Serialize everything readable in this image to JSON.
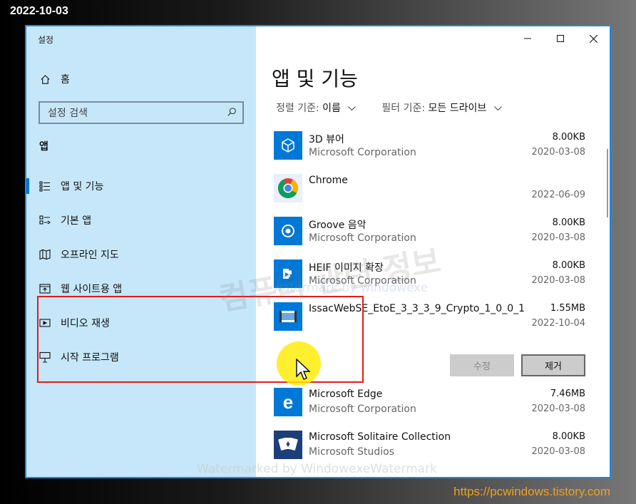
{
  "stamp": {
    "date": "2022-10-03",
    "url": "https://pcwindows.tistory.com"
  },
  "window": {
    "title": "설정"
  },
  "sidebar": {
    "home": "홈",
    "search_placeholder": "설정 검색",
    "section": "앱",
    "items": [
      {
        "label": "앱 및 기능",
        "icon": "apps-features-icon",
        "active": true
      },
      {
        "label": "기본 앱",
        "icon": "default-apps-icon",
        "active": false
      },
      {
        "label": "오프라인 지도",
        "icon": "offline-maps-icon",
        "active": false
      },
      {
        "label": "웹 사이트용 앱",
        "icon": "apps-for-websites-icon",
        "active": false
      },
      {
        "label": "비디오 재생",
        "icon": "video-playback-icon",
        "active": false
      },
      {
        "label": "시작 프로그램",
        "icon": "startup-icon",
        "active": false
      }
    ]
  },
  "main": {
    "title": "앱 및 기능",
    "sort_label": "정렬 기준:",
    "sort_value": "이름",
    "filter_label": "필터 기준:",
    "filter_value": "모든 드라이브",
    "apps": [
      {
        "name": "3D 뷰어",
        "publisher": "Microsoft Corporation",
        "size": "8.00KB",
        "date": "2020-03-08",
        "icon": "3d-viewer-icon"
      },
      {
        "name": "Chrome",
        "publisher": "",
        "size": "",
        "date": "2022-06-09",
        "icon": "chrome-icon"
      },
      {
        "name": "Groove 음악",
        "publisher": "Microsoft Corporation",
        "size": "8.00KB",
        "date": "2020-03-08",
        "icon": "groove-music-icon"
      },
      {
        "name": "HEIF 이미지 확장",
        "publisher": "Microsoft Corporation",
        "size": "8.00KB",
        "date": "2020-03-08",
        "icon": "heif-extension-icon"
      },
      {
        "name": "IssacWebSE_EtoE_3_3_3_9_Crypto_1_0_0_1",
        "publisher": "",
        "size": "1.55MB",
        "date": "2022-10-04",
        "icon": "issac-app-icon"
      },
      {
        "name": "Microsoft Edge",
        "publisher": "Microsoft Corporation",
        "size": "7.46MB",
        "date": "2020-03-08",
        "icon": "edge-icon"
      },
      {
        "name": "Microsoft Solitaire Collection",
        "publisher": "Microsoft Studios",
        "size": "8.00KB",
        "date": "2020-03-08",
        "icon": "solitaire-icon"
      }
    ],
    "modify_label": "수정",
    "uninstall_label": "제거"
  },
  "watermarks": {
    "korean": "컴퓨터 관련 정보",
    "mid": "watermark by windowexe",
    "bottom": "Watermarked by WindowexeWatermark"
  }
}
